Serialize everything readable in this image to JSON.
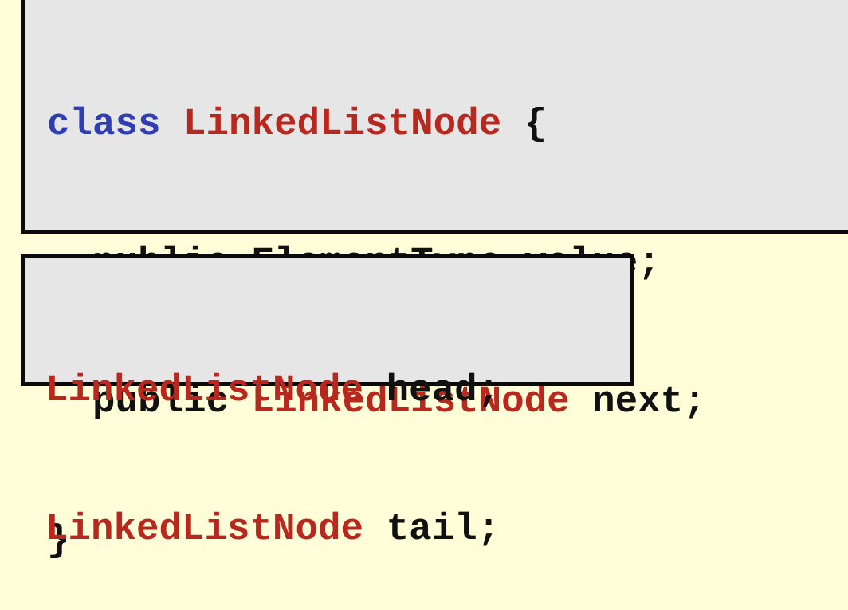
{
  "class_definition": {
    "line_1": {
      "keyword": "class",
      "class_name": "LinkedListNode",
      "open_brace": "{"
    },
    "line_2": {
      "modifier": "public",
      "type": "ElementType",
      "field_name": "value",
      "terminator": ";"
    },
    "line_3": {
      "modifier": "public",
      "type": "LinkedListNode",
      "field_name": "next",
      "terminator": ";"
    },
    "line_4": {
      "close_brace": "}"
    }
  },
  "variable_declarations": [
    {
      "type": "LinkedListNode",
      "name": "head",
      "terminator": ";"
    },
    {
      "type": "LinkedListNode",
      "name": "tail",
      "terminator": ";"
    }
  ],
  "colors": {
    "background": "#fffed8",
    "box_fill": "#e6e6e6",
    "border": "#0b0b0b",
    "keyword": "#2f3eb3",
    "linked_list_node_type": "#b8281f",
    "plain_text": "#111111"
  }
}
